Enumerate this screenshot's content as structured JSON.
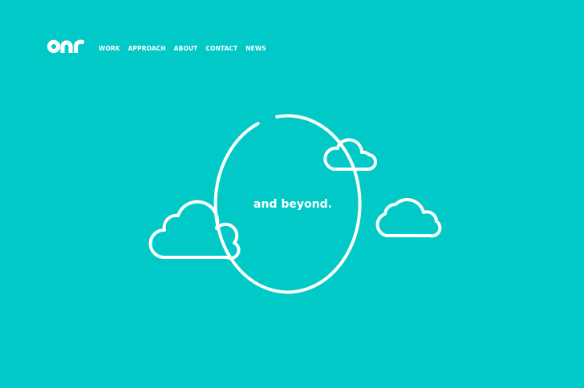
{
  "brand": {
    "logo_icon": "one-logo-icon",
    "colors": {
      "background": "#00C9C8",
      "foreground": "#FFFFFF"
    }
  },
  "nav": {
    "items": [
      {
        "label": "WORK"
      },
      {
        "label": "APPROACH"
      },
      {
        "label": "ABOUT"
      },
      {
        "label": "CONTACT"
      },
      {
        "label": "NEWS"
      }
    ]
  },
  "hero": {
    "tagline": "and beyond.",
    "icons": [
      "orbit-ring-icon",
      "cloud-icon",
      "cloud-icon",
      "cloud-icon"
    ]
  }
}
